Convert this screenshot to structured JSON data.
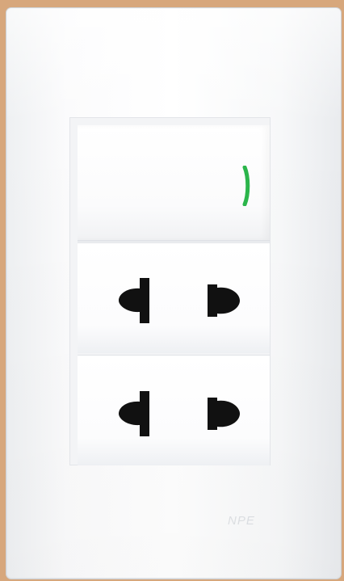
{
  "photo": {
    "background_color": "#d7a77c",
    "plate_color": "#ffffff",
    "indicator_color": "#2bb54b",
    "socket_hole_color": "#111111",
    "brand_mark": "NPE"
  },
  "switch": {
    "icon": "indicator-light-icon"
  },
  "sockets": [
    {
      "name": "upper-socket",
      "icon": "outlet-icon"
    },
    {
      "name": "lower-socket",
      "icon": "outlet-icon"
    }
  ]
}
